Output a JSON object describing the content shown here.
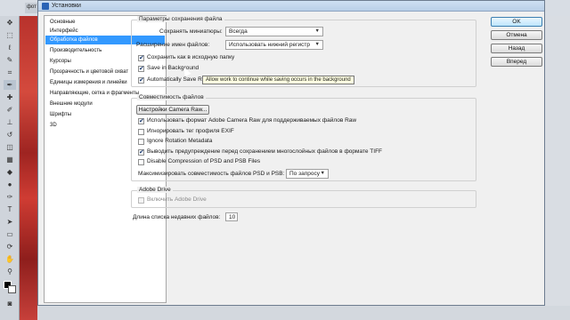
{
  "background": {
    "doc_tab": "фот"
  },
  "dialog": {
    "title": "Установки",
    "nav_items": [
      "Основные",
      "Интерфейс",
      "Обработка файлов",
      "Производительность",
      "Курсоры",
      "Прозрачность и цветовой охват",
      "Единицы измерения и линейки",
      "Направляющие, сетка и фрагменты",
      "Внешние модули",
      "Шрифты",
      "3D"
    ],
    "active_nav_index": 2,
    "buttons": {
      "ok": "OK",
      "cancel": "Отмена",
      "prev": "Назад",
      "next": "Вперед"
    },
    "file_save": {
      "title": "Параметры сохранения файла",
      "thumbnails_label": "Сохранять миниатюры:",
      "thumbnails_value": "Всегда",
      "ext_label": "Расширение имен файлов:",
      "ext_value": "Использовать нижний регистр",
      "save_original_label": "Сохранить как в исходную папку",
      "save_original_checked": true,
      "save_bg_label": "Save in Background",
      "save_bg_checked": true,
      "autosave_label": "Automatically Save R",
      "autosave_checked": true,
      "tooltip": "Allow work to continue while saving occurs in the background"
    },
    "compat": {
      "title": "Совместимость файлов",
      "camera_raw_button": "Настройки Camera Raw...",
      "use_acr_label": "Использовать формат Adobe Camera Raw для поддерживаемых файлов Raw",
      "use_acr_checked": true,
      "ignore_exif_label": "Игнорировать тег профиля EXIF",
      "ignore_exif_checked": false,
      "ignore_rotation_label": "Ignore Rotation Metadata",
      "ignore_rotation_checked": false,
      "warn_tiff_label": "Выводить предупреждение перед сохранением многослойных файлов в формате TIFF",
      "warn_tiff_checked": true,
      "disable_compression_label": "Disable Compression of PSD and PSB Files",
      "disable_compression_checked": false,
      "maximize_label": "Максимизировать совместимость файлов PSD и PSB:",
      "maximize_value": "По запросу"
    },
    "adobe_drive": {
      "title": "Adobe Drive",
      "enable_label": "Включить Adobe Drive",
      "enable_checked": false
    },
    "recent": {
      "label": "Длина списка недавних файлов:",
      "value": "10"
    }
  }
}
